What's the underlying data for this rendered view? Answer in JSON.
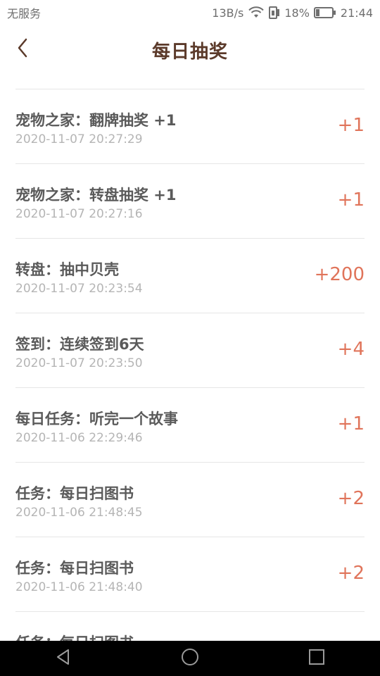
{
  "status_bar": {
    "carrier": "无服务",
    "speed": "13B/s",
    "battery": "18%",
    "time": "21:44",
    "icons": [
      "wifi-icon",
      "sim-icon",
      "battery-icon"
    ]
  },
  "header": {
    "title": "每日抽奖",
    "back_icon": "chevron-left-icon"
  },
  "records": [
    {
      "title": "宠物之家：翻牌抽奖 +1",
      "time": "2020-11-07 20:27:29",
      "value": "+1"
    },
    {
      "title": "宠物之家：转盘抽奖 +1",
      "time": "2020-11-07 20:27:16",
      "value": "+1"
    },
    {
      "title": "转盘：抽中贝壳",
      "time": "2020-11-07 20:23:54",
      "value": "+200"
    },
    {
      "title": "签到：连续签到6天",
      "time": "2020-11-07 20:23:50",
      "value": "+4"
    },
    {
      "title": "每日任务：听完一个故事",
      "time": "2020-11-06 22:29:46",
      "value": "+1"
    },
    {
      "title": "任务：每日扫图书",
      "time": "2020-11-06 21:48:45",
      "value": "+2"
    },
    {
      "title": "任务：每日扫图书",
      "time": "2020-11-06 21:48:40",
      "value": "+2"
    },
    {
      "title": "任务：每日扫图书",
      "time": "",
      "value": ""
    }
  ],
  "nav_bar": {
    "buttons": [
      "back-triangle-icon",
      "home-circle-icon",
      "recents-square-icon"
    ]
  },
  "colors": {
    "title": "#5b3a2a",
    "value": "#e0745a",
    "item_text": "#5a5a5a",
    "time_text": "#b5b5b5",
    "divider": "#e6e6e6"
  }
}
